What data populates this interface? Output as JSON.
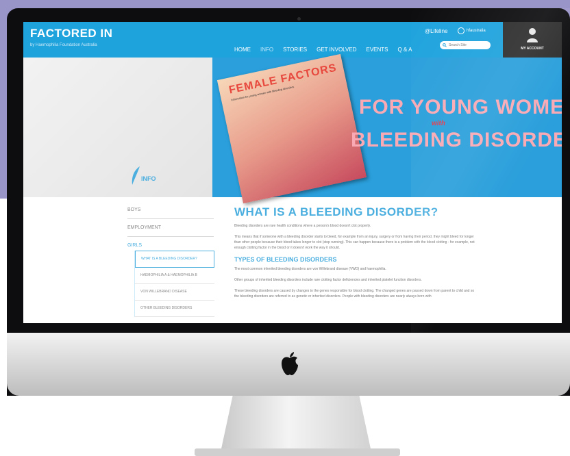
{
  "site": {
    "logo": "FACTORED IN",
    "tagline": "by Haemophilia Foundation Australia",
    "nav": [
      "HOME",
      "INFO",
      "STORIES",
      "GET INVOLVED",
      "EVENTS",
      "Q & A"
    ],
    "active_nav": "INFO",
    "brand_links": [
      "Lifeline",
      "hfaustralia"
    ],
    "search_placeholder": "Search Site",
    "account_label": "MY ACCOUNT"
  },
  "hero": {
    "section_label": "INFO",
    "magazine_title": "FEMALE FACTORS",
    "magazine_subtitle": "Information for young women with bleeding disorders",
    "headline_line1": "FOR YOUNG WOMEN",
    "headline_with": "with",
    "headline_line2": "BLEEDING DISORDERS"
  },
  "sidebar": {
    "items": [
      "BOYS",
      "EMPLOYMENT",
      "GIRLS"
    ],
    "sub_items": [
      "WHAT IS A BLEEDING DISORDER?",
      "HAEMOPHILIA A & HAEMOPHILIA B",
      "VON WILLEBRAND DISEASE",
      "OTHER BLEEDING DISORDERS"
    ]
  },
  "article": {
    "title": "WHAT IS A BLEEDING DISORDER?",
    "intro": "Bleeding disorders are rare health conditions where a person's blood doesn't clot properly.",
    "para2": "This means that if someone with a bleeding disorder starts to bleed, for example from an injury, surgery or from having their period, they might bleed for longer than other people because their blood takes longer to clot (stop running). This can happen because there is a problem with the blood clotting - for example, not enough clotting factor in the blood or it doesn't work the way it should.",
    "section_title": "TYPES OF BLEEDING DISORDERS",
    "para3": "The most common inherited bleeding disorders are von Willebrand disease (VWD) and haemophilia.",
    "para4": "Other groups of inherited bleeding disorders include rare clotting factor deficiencies and inherited platelet function disorders.",
    "para5": "These bleeding disorders are caused by changes to the genes responsible for blood clotting. The changed genes are passed down from parent to child and so the bleeding disorders are referred to as genetic or inherited disorders. People with bleeding disorders are nearly always born with"
  }
}
